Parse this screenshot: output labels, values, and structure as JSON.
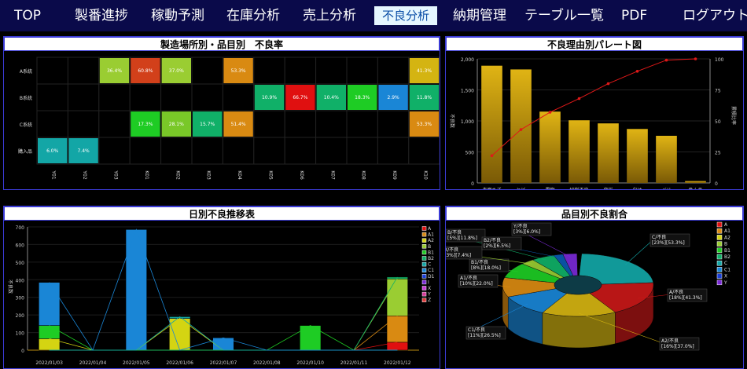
{
  "nav": {
    "items": [
      "TOP",
      "製番進捗",
      "稼動予測",
      "在庫分析",
      "売上分析",
      "不良分析",
      "納期管理",
      "テーブル一覧",
      "PDF",
      "ログアウト"
    ],
    "active_index": 5,
    "colors": {
      "bar": "#0a0a4a",
      "active_bg": "#e6f7ff",
      "active_text": "#0a4da6"
    }
  },
  "panels": {
    "heatmap_title": "製造場所別・品目別　不良率",
    "pareto_title": "不良理由別パレート図",
    "daily_title": "日別不良推移表",
    "pie_title": "品目別不良割合"
  },
  "chart_data": [
    {
      "type": "heatmap",
      "title": "製造場所別・品目別　不良率",
      "rows": [
        "A系統",
        "B系統",
        "C系統",
        "購入品"
      ],
      "columns": [
        "Y01",
        "Y02",
        "Y03",
        "K01",
        "K02",
        "K03",
        "K04",
        "K05",
        "K06",
        "K07",
        "K08",
        "K09",
        "K10"
      ],
      "cells": [
        {
          "row": "A系統",
          "col": "Y03",
          "value": "36.4%",
          "color": "#9acd32"
        },
        {
          "row": "A系統",
          "col": "K01",
          "value": "60.8%",
          "color": "#d2401a"
        },
        {
          "row": "A系統",
          "col": "K02",
          "value": "37.0%",
          "color": "#9acd32"
        },
        {
          "row": "A系統",
          "col": "K04",
          "value": "53.3%",
          "color": "#d98a12"
        },
        {
          "row": "A系統",
          "col": "K10",
          "value": "41.3%",
          "color": "#d4b412"
        },
        {
          "row": "B系統",
          "col": "K05",
          "value": "10.9%",
          "color": "#10b068"
        },
        {
          "row": "B系統",
          "col": "K06",
          "value": "66.7%",
          "color": "#e01010"
        },
        {
          "row": "B系統",
          "col": "K07",
          "value": "10.4%",
          "color": "#10b068"
        },
        {
          "row": "B系統",
          "col": "K08",
          "value": "18.3%",
          "color": "#1ecc24"
        },
        {
          "row": "B系統",
          "col": "K09",
          "value": "2.9%",
          "color": "#1a86d6"
        },
        {
          "row": "B系統",
          "col": "K10",
          "value": "11.8%",
          "color": "#10b068"
        },
        {
          "row": "C系統",
          "col": "K01",
          "value": "17.3%",
          "color": "#1ecc24"
        },
        {
          "row": "C系統",
          "col": "K02",
          "value": "28.1%",
          "color": "#79c828"
        },
        {
          "row": "C系統",
          "col": "K03",
          "value": "15.7%",
          "color": "#10b068"
        },
        {
          "row": "C系統",
          "col": "K04",
          "value": "51.4%",
          "color": "#d98a12"
        },
        {
          "row": "C系統",
          "col": "K10",
          "value": "53.3%",
          "color": "#d98a12"
        },
        {
          "row": "購入品",
          "col": "Y01",
          "value": "6.0%",
          "color": "#13a6a6"
        },
        {
          "row": "購入品",
          "col": "Y02",
          "value": "7.4%",
          "color": "#13a6a6"
        }
      ]
    },
    {
      "type": "bar",
      "title": "不良理由別パレート図",
      "categories": [
        "表面キズ",
        "ヒビ",
        "異物",
        "切削不良",
        "変形",
        "欠け",
        "バリ",
        "色ムラ"
      ],
      "values": [
        1890,
        1830,
        1150,
        1010,
        960,
        870,
        760,
        30
      ],
      "cumulative_percent": [
        22,
        43,
        57,
        68,
        80,
        90,
        99,
        100
      ],
      "ylabel": "不良数",
      "y2label": "累積比率",
      "ylim": [
        0,
        2000
      ],
      "y2lim": [
        0,
        100
      ],
      "yticks": [
        "0",
        "500",
        "1,000",
        "1,500",
        "2,000"
      ],
      "y2ticks": [
        "0",
        "25",
        "50",
        "75",
        "100"
      ],
      "colors": {
        "bar": "#c89a0c",
        "line": "#e01818"
      }
    },
    {
      "type": "bar",
      "title": "日別不良推移表",
      "categories": [
        "2022/01/03",
        "2022/01/04",
        "2022/01/05",
        "2022/01/06",
        "2022/01/07",
        "2022/01/08",
        "2022/01/10",
        "2022/01/11",
        "2022/01/12"
      ],
      "yticks": [
        "0",
        "100",
        "200",
        "300",
        "400",
        "500",
        "600",
        "700"
      ],
      "ylabel": "不良数",
      "ylim": [
        0,
        700
      ],
      "stacked": true,
      "series": [
        {
          "name": "A",
          "color": "#e01010",
          "values": [
            0,
            0,
            0,
            0,
            0,
            0,
            0,
            0,
            45
          ]
        },
        {
          "name": "A1",
          "color": "#d98a12",
          "values": [
            0,
            0,
            0,
            0,
            0,
            0,
            0,
            0,
            150
          ]
        },
        {
          "name": "A2",
          "color": "#d4d412",
          "values": [
            65,
            0,
            0,
            180,
            0,
            0,
            0,
            0,
            0
          ]
        },
        {
          "name": "B",
          "color": "#9acd32",
          "values": [
            0,
            0,
            0,
            0,
            0,
            0,
            0,
            0,
            210
          ]
        },
        {
          "name": "B1",
          "color": "#1ecc24",
          "values": [
            75,
            0,
            0,
            0,
            0,
            0,
            140,
            0,
            0
          ]
        },
        {
          "name": "B2",
          "color": "#10b068",
          "values": [
            0,
            0,
            0,
            0,
            0,
            0,
            0,
            0,
            10
          ]
        },
        {
          "name": "C",
          "color": "#13a6a6",
          "values": [
            0,
            0,
            0,
            10,
            0,
            0,
            0,
            0,
            0
          ]
        },
        {
          "name": "C1",
          "color": "#1a86d6",
          "values": [
            245,
            0,
            685,
            0,
            70,
            0,
            0,
            0,
            0
          ]
        },
        {
          "name": "D1",
          "color": "#1a3fd6",
          "values": [
            0,
            0,
            0,
            0,
            0,
            0,
            0,
            0,
            0
          ]
        },
        {
          "name": "I",
          "color": "#7a2ad6",
          "values": [
            0,
            0,
            0,
            0,
            0,
            0,
            0,
            0,
            0
          ]
        },
        {
          "name": "X",
          "color": "#c83ad6",
          "values": [
            0,
            0,
            0,
            0,
            0,
            0,
            0,
            0,
            0
          ]
        },
        {
          "name": "Y",
          "color": "#d63a9a",
          "values": [
            0,
            0,
            0,
            0,
            0,
            0,
            0,
            0,
            0
          ]
        },
        {
          "name": "Z",
          "color": "#e03a3a",
          "values": [
            0,
            0,
            0,
            0,
            0,
            0,
            0,
            0,
            0
          ]
        }
      ]
    },
    {
      "type": "pie",
      "title": "品目別不良割合",
      "slices": [
        {
          "name": "C/不良",
          "label1": "C/不良",
          "label2": "[23%][53.3%]",
          "percent": 23,
          "color": "#13a6a6"
        },
        {
          "name": "A/不良",
          "label1": "A/不良",
          "label2": "[18%][41.3%]",
          "percent": 18,
          "color": "#c81818"
        },
        {
          "name": "A2/不良",
          "label1": "A2/不良",
          "label2": "[16%][37.0%]",
          "percent": 16,
          "color": "#d4b412"
        },
        {
          "name": "C1/不良",
          "label1": "C1/不良",
          "label2": "[11%][26.5%]",
          "percent": 11,
          "color": "#1a86d6"
        },
        {
          "name": "A1/不良",
          "label1": "A1/不良",
          "label2": "[10%][22.0%]",
          "percent": 10,
          "color": "#d98a12"
        },
        {
          "name": "B1/不良",
          "label1": "B1/不良",
          "label2": "[8%][18.0%]",
          "percent": 8,
          "color": "#1ecc24"
        },
        {
          "name": "X/不良",
          "label1": "X/不良",
          "label2": "[3%][7.4%]",
          "percent": 3,
          "color": "#9acd32"
        },
        {
          "name": "B/不良",
          "label1": "B/不良",
          "label2": "[5%][11.8%]",
          "percent": 5,
          "color": "#10b068"
        },
        {
          "name": "B2/不良",
          "label1": "B2/不良",
          "label2": "[2%][6.5%]",
          "percent": 2,
          "color": "#0a5ab0"
        },
        {
          "name": "Y/不良",
          "label1": "Y/不良",
          "label2": "[3%][6.0%]",
          "percent": 3,
          "color": "#7a2ad6"
        }
      ],
      "legend": [
        "A",
        "A1",
        "A2",
        "B",
        "B1",
        "B2",
        "C",
        "C1",
        "X",
        "Y"
      ],
      "legend_colors": [
        "#e01010",
        "#d98a12",
        "#d4d412",
        "#9acd32",
        "#1ecc24",
        "#10b068",
        "#13a6a6",
        "#1a86d6",
        "#1a3fd6",
        "#7a2ad6"
      ]
    }
  ]
}
